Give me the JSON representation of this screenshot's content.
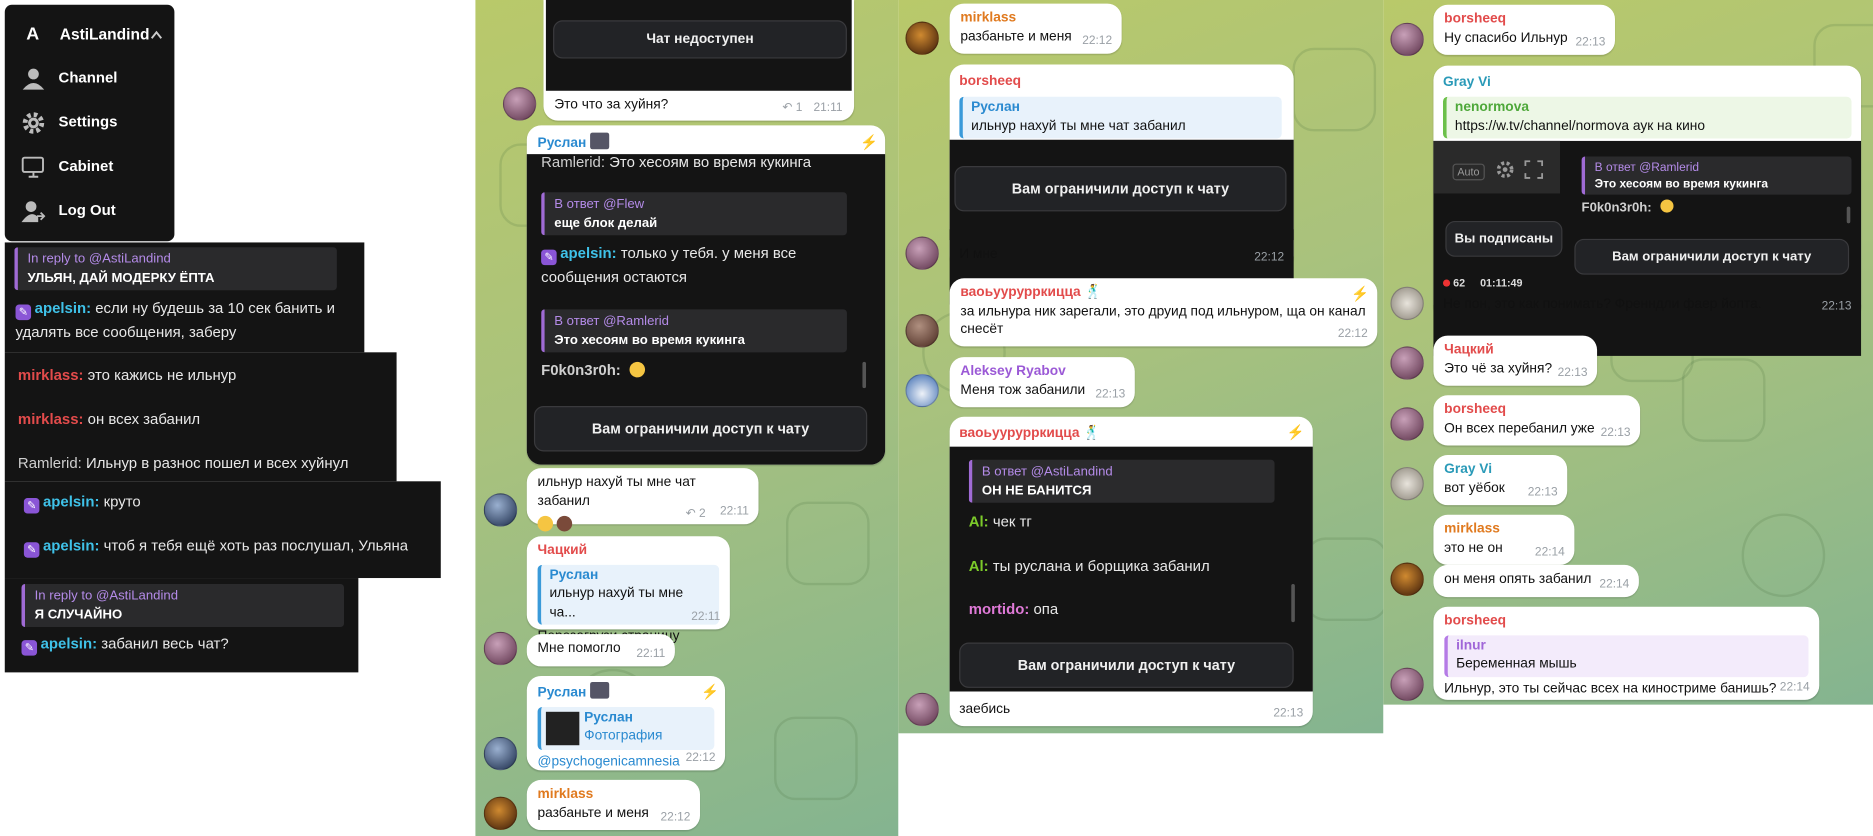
{
  "menu": {
    "brand_letter": "A",
    "user": "AstiLandind",
    "items": [
      {
        "label": "Channel",
        "icon": "user-icon"
      },
      {
        "label": "Settings",
        "icon": "gear-icon"
      },
      {
        "label": "Cabinet",
        "icon": "monitor-icon"
      },
      {
        "label": "Log Out",
        "icon": "logout-icon"
      }
    ]
  },
  "panel1": {
    "reply1": {
      "head": "In reply to @AstiLandind",
      "text": "УЛЬЯН, ДАЙ МОДЕРКУ ЁПТА"
    },
    "l1_name": "apelsin:",
    "l1_text": "если ну будешь за 10 сек банить и",
    "l1_text2": "удалять все сообщения, заберу",
    "l2_name": "mirklass:",
    "l2_text": "это кажись не ильнур",
    "l3_name": "mirklass:",
    "l3_text": "он всех забанил",
    "l4_name": "Ramlerid:",
    "l4_text": "Ильнур в разнос пошел и всех хуйнул",
    "l5_name": "apelsin:",
    "l5_text": "круто",
    "l6_name": "apelsin:",
    "l6_text": "чтоб я тебя ещё хоть раз послушал, Ульяна",
    "reply2": {
      "head": "In reply to @AstiLandind",
      "text": "Я СЛУЧАЙНО"
    },
    "l7_name": "apelsin:",
    "l7_text": "забанил весь чат?"
  },
  "col2": {
    "top_btn": "Чат недоступен",
    "top_msg": "Это что за хуйня?",
    "top_replies": "1",
    "top_time": "21:11",
    "ruslan_name": "Руслан",
    "ram_line_name": "Ramlerid:",
    "ram_line_text": "Это хесоям во время кукинга",
    "q1_head": "В ответ @Flew",
    "q1_text": "еще блок делай",
    "ap_name": "apelsin:",
    "ap_text": "только у тебя. у меня все",
    "ap_text2": "сообщения остаются",
    "q2_head": "В ответ @Ramlerid",
    "q2_text": "Это хесоям во время кукинга",
    "f0_name": "F0k0n3r0h:",
    "ban_btn": "Вам ограничили доступ к чату",
    "m1_text": "ильнур нахуй ты мне чат забанил",
    "m1_replies": "2",
    "m1_time": "22:11",
    "m2_name": "Чацкий",
    "m2_qname": "Руслан",
    "m2_qtext": "ильнур нахуй ты мне ча...",
    "m2_text": "Перезагрузи страницу",
    "m2_time": "22:11",
    "m3_text": "Мне помогло",
    "m3_time": "22:11",
    "m4_name": "Руслан",
    "m4_qname": "Руслан",
    "m4_qtext": "Фотография",
    "m4_text": "@psychogenicamnesia",
    "m4_time": "22:12",
    "m5_name": "mirklass",
    "m5_text": "разбаньте и меня",
    "m5_time": "22:12"
  },
  "col3": {
    "m1_name": "mirklass",
    "m1_text": "разбаньте и меня",
    "m1_time": "22:12",
    "m2_name": "borsheeq",
    "m2_qname": "Руслан",
    "m2_qtext": "ильнур нахуй ты мне чат забанил",
    "m2_btn": "Вам ограничили доступ к чату",
    "m2_text": "И мне",
    "m2_time": "22:12",
    "m3_name": "ваоьуурурркицца",
    "m3_text": "за ильнура ник зарегали, это друид под ильнуром, ща он канал",
    "m3_text2": "снесёт",
    "m3_time": "22:12",
    "m4_name": "Aleksey Ryabov",
    "m4_text": "Меня тож забанили",
    "m4_time": "22:13",
    "m5_name": "ваоьуурурркицца",
    "m5_qhead": "В ответ @AstiLandind",
    "m5_qtext": "ОН НЕ БАНИТСЯ",
    "m5_l1n": "Al:",
    "m5_l1t": "чек тг",
    "m5_l2n": "Al:",
    "m5_l2t": "ты руслана и борщика забанил",
    "m5_l3n": "mortido:",
    "m5_l3t": "опа",
    "m5_btn": "Вам ограничили доступ к чату",
    "m5_text": "заебись",
    "m5_time": "22:13"
  },
  "col4": {
    "m1_name": "borsheeq",
    "m1_text": "Ну спасибо Ильнур",
    "m1_time": "22:13",
    "m2_name": "Gray Vi",
    "m2_qname": "nenormova",
    "m2_qtext": "https://w.tv/channel/normova аук на кино",
    "m2_auto": "Auto",
    "m2_rhead": "В ответ @Ramlerid",
    "m2_rtext": "Это хесоям во время кукинга",
    "m2_f0": "F0k0n3r0h:",
    "m2_sub": "Вы подписаны",
    "m2_ban": "Вам ограничили доступ к чату",
    "m2_viewers": "62",
    "m2_dur": "01:11:49",
    "m2_text": "Не пон, это как понимать? Френндли фаер йопта.",
    "m2_time": "22:13",
    "m3_name": "Чацкий",
    "m3_text": "Это чё за хуйня?",
    "m3_time": "22:13",
    "m4_name": "borsheeq",
    "m4_text": "Он всех перебанил уже",
    "m4_time": "22:13",
    "m5_name": "Gray Vi",
    "m5_text": "вот уёбок",
    "m5_time": "22:13",
    "m6_name": "mirklass",
    "m6_text": "это не он",
    "m6_time": "22:14",
    "m7_text": "он меня опять забанил",
    "m7_time": "22:14",
    "m8_name": "borsheeq",
    "m8_qname": "ilnur",
    "m8_qtext": "Беременная мышь",
    "m8_text": "Ильнур, это ты сейчас всех на киностриме банишь?",
    "m8_time": "22:14"
  }
}
